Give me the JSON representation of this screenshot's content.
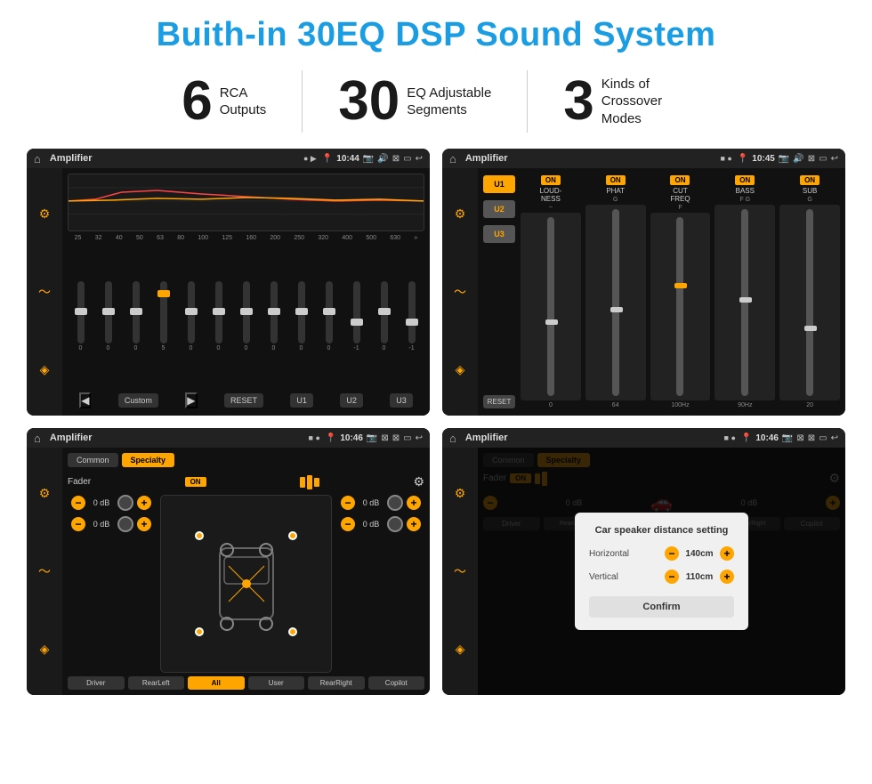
{
  "page": {
    "title": "Buith-in 30EQ DSP Sound System",
    "stats": [
      {
        "number": "6",
        "label": "RCA\nOutputs"
      },
      {
        "number": "30",
        "label": "EQ Adjustable\nSegments"
      },
      {
        "number": "3",
        "label": "Kinds of\nCrossover Modes"
      }
    ]
  },
  "screen1": {
    "app_title": "Amplifier",
    "time": "10:44",
    "freq_labels": [
      "25",
      "32",
      "40",
      "50",
      "63",
      "80",
      "100",
      "125",
      "160",
      "200",
      "250",
      "320",
      "400",
      "500",
      "630"
    ],
    "slider_values": [
      "0",
      "0",
      "0",
      "5",
      "0",
      "0",
      "0",
      "0",
      "0",
      "0",
      "-1",
      "0",
      "-1"
    ],
    "buttons": [
      "Custom",
      "RESET",
      "U1",
      "U2",
      "U3"
    ],
    "presets": [
      "Custom"
    ]
  },
  "screen2": {
    "app_title": "Amplifier",
    "time": "10:45",
    "presets": [
      "U1",
      "U2",
      "U3"
    ],
    "channels": [
      "LOUDNESS",
      "PHAT",
      "CUT FREQ",
      "BASS",
      "SUB"
    ],
    "channel_labels": [
      "G",
      "G",
      "F",
      "F G",
      "G"
    ]
  },
  "screen3": {
    "app_title": "Amplifier",
    "time": "10:46",
    "tabs": [
      "Common",
      "Specialty"
    ],
    "fader_label": "Fader",
    "on_label": "ON",
    "buttons": [
      "Driver",
      "RearLeft",
      "All",
      "User",
      "RearRight",
      "Copilot"
    ],
    "vol_rows": [
      {
        "val": "0 dB"
      },
      {
        "val": "0 dB"
      },
      {
        "val": "0 dB"
      },
      {
        "val": "0 dB"
      }
    ]
  },
  "screen4": {
    "app_title": "Amplifier",
    "time": "10:46",
    "tabs": [
      "Common",
      "Specialty"
    ],
    "on_label": "ON",
    "buttons": [
      "Driver",
      "RearLeft",
      "All",
      "User",
      "RearRight",
      "Copilot"
    ],
    "vol_rows": [
      {
        "val": "0 dB"
      },
      {
        "val": "0 dB"
      }
    ],
    "modal": {
      "title": "Car speaker distance setting",
      "horizontal_label": "Horizontal",
      "horizontal_val": "140cm",
      "vertical_label": "Vertical",
      "vertical_val": "110cm",
      "confirm_label": "Confirm"
    }
  }
}
